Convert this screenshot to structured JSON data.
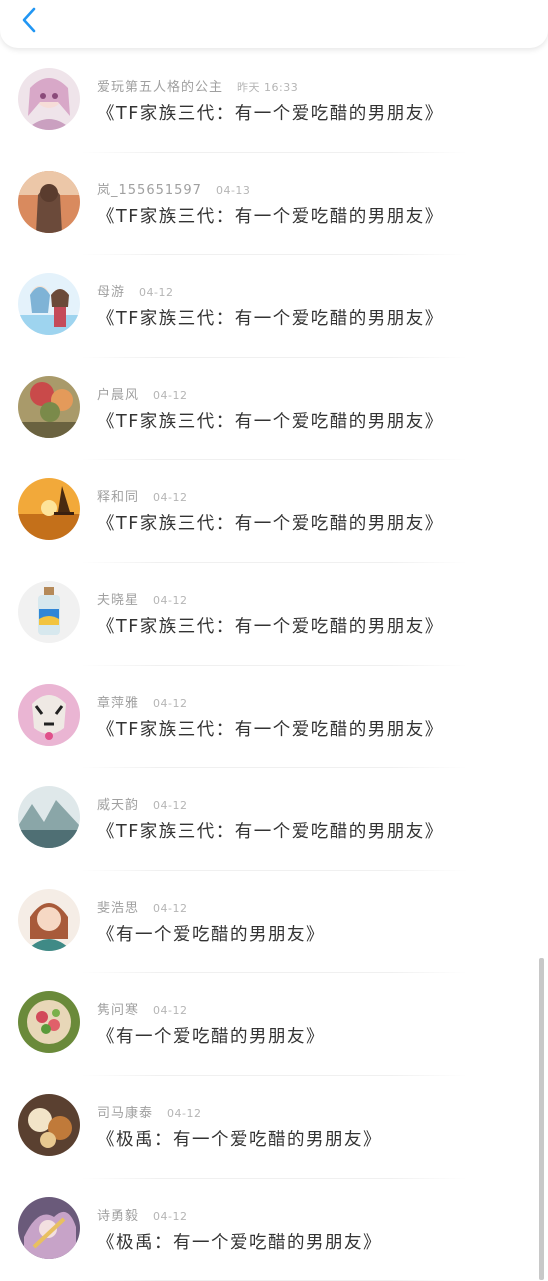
{
  "header": {
    "back_icon": "chevron-left-icon",
    "accent": "#2196F3"
  },
  "items": [
    {
      "user": "爱玩第五人格的公主",
      "time": "昨天 16:33",
      "title": "《TF家族三代：有一个爱吃醋的男朋友》"
    },
    {
      "user": "岚_155651597",
      "time": "04-13",
      "title": "《TF家族三代：有一个爱吃醋的男朋友》"
    },
    {
      "user": "母游",
      "time": "04-12",
      "title": "《TF家族三代：有一个爱吃醋的男朋友》"
    },
    {
      "user": "户晨风",
      "time": "04-12",
      "title": "《TF家族三代：有一个爱吃醋的男朋友》"
    },
    {
      "user": "释和同",
      "time": "04-12",
      "title": "《TF家族三代：有一个爱吃醋的男朋友》"
    },
    {
      "user": "夫晓星",
      "time": "04-12",
      "title": "《TF家族三代：有一个爱吃醋的男朋友》"
    },
    {
      "user": "章萍雅",
      "time": "04-12",
      "title": "《TF家族三代：有一个爱吃醋的男朋友》"
    },
    {
      "user": "威天韵",
      "time": "04-12",
      "title": "《TF家族三代：有一个爱吃醋的男朋友》"
    },
    {
      "user": "斐浩思",
      "time": "04-12",
      "title": "《有一个爱吃醋的男朋友》"
    },
    {
      "user": "隽问寒",
      "time": "04-12",
      "title": "《有一个爱吃醋的男朋友》"
    },
    {
      "user": "司马康泰",
      "time": "04-12",
      "title": "《极禹：有一个爱吃醋的男朋友》"
    },
    {
      "user": "诗勇毅",
      "time": "04-12",
      "title": "《极禹：有一个爱吃醋的男朋友》"
    }
  ]
}
